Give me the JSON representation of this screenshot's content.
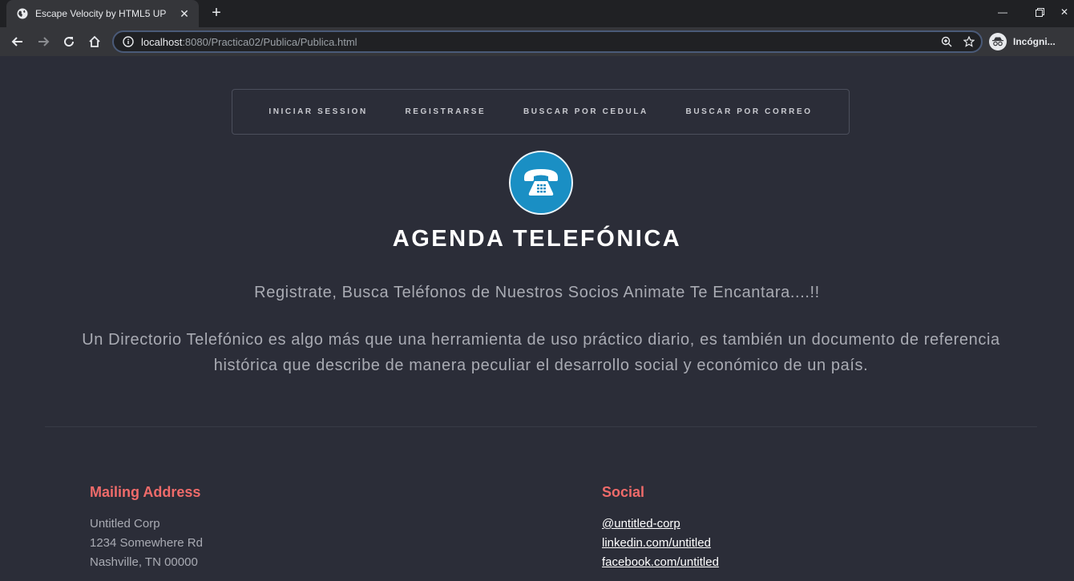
{
  "browser": {
    "tab_title": "Escape Velocity by HTML5 UP",
    "url_host": "localhost",
    "url_rest": ":8080/Practica02/Publica/Publica.html",
    "profile_label": "Incógni..."
  },
  "nav": {
    "items": [
      "INICIAR SESSION",
      "REGISTRARSE",
      "BUSCAR POR CEDULA",
      "BUSCAR POR CORREO"
    ]
  },
  "logo_icon": "telephone-icon",
  "main": {
    "title": "AGENDA TELEFÓNICA",
    "tagline": "Registrate, Busca Teléfonos de Nuestros Socios Animate Te Encantara....!!",
    "description": "Un Directorio Telefónico es algo más que una herramienta de uso práctico diario, es también un documento de referencia histórica que describe de manera peculiar el desarrollo social y económico de un país."
  },
  "footer": {
    "mailing": {
      "heading": "Mailing Address",
      "lines": [
        "Untitled Corp",
        "1234 Somewhere Rd",
        "Nashville, TN 00000"
      ]
    },
    "social": {
      "heading": "Social",
      "links": [
        "@untitled-corp",
        "linkedin.com/untitled",
        "facebook.com/untitled"
      ]
    }
  },
  "colors": {
    "page_bg": "#2b2d38",
    "accent": "#ef6b6a",
    "logo_bg": "#1a8fc4"
  }
}
